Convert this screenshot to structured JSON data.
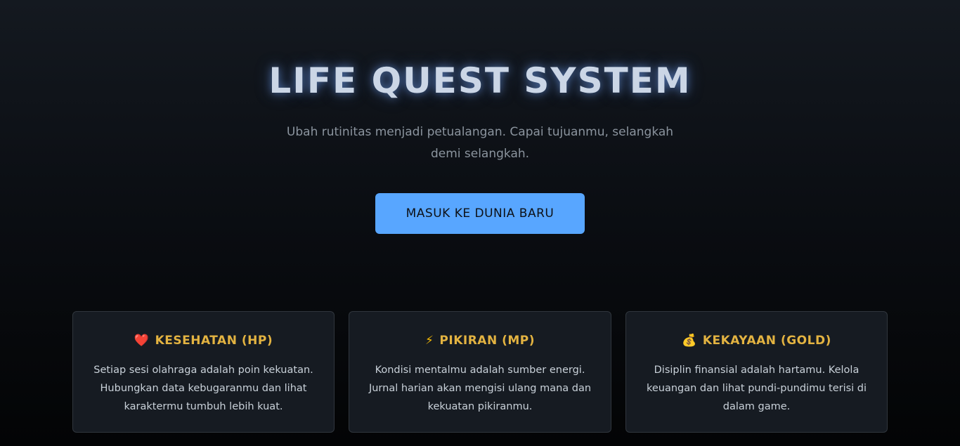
{
  "hero": {
    "title": "LIFE QUEST SYSTEM",
    "subtitle": "Ubah rutinitas menjadi petualangan. Capai tujuanmu, selangkah demi selangkah.",
    "cta_label": "MASUK KE DUNIA BARU"
  },
  "features": [
    {
      "icon": "heart-icon",
      "icon_glyph": "❤️",
      "title": "KESEHATAN (HP)",
      "description": "Setiap sesi olahraga adalah poin kekuatan. Hubungkan data kebugaranmu dan lihat karaktermu tumbuh lebih kuat."
    },
    {
      "icon": "lightning-icon",
      "icon_glyph": "⚡",
      "title": "PIKIRAN (MP)",
      "description": "Kondisi mentalmu adalah sumber energi. Jurnal harian akan mengisi ulang mana dan kekuatan pikiranmu."
    },
    {
      "icon": "money-bag-icon",
      "icon_glyph": "💰",
      "title": "KEKAYAAN (GOLD)",
      "description": "Disiplin finansial adalah hartamu. Kelola keuangan dan lihat pundi-pundimu terisi di dalam game."
    }
  ],
  "colors": {
    "accent": "#58a6ff",
    "gold": "#e3b341",
    "card_bg": "#161b22",
    "card_border": "#30363d"
  }
}
